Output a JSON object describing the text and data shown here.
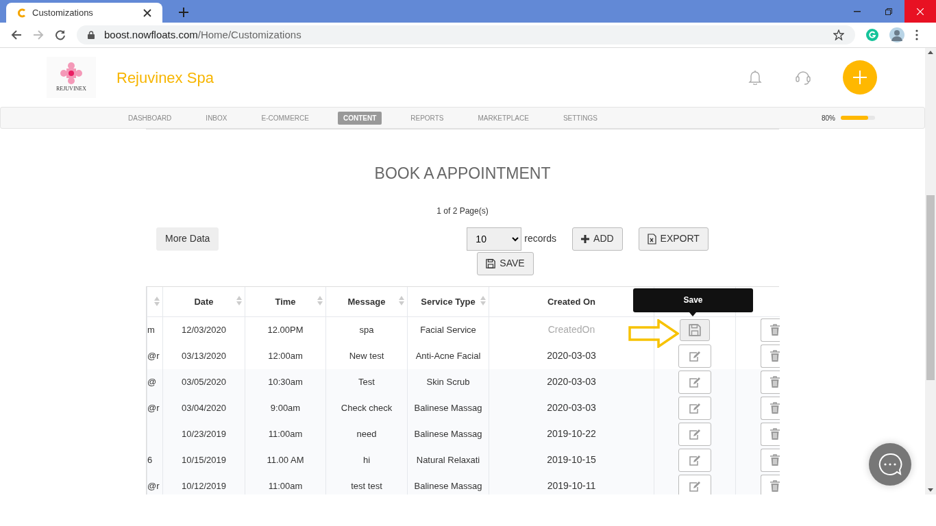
{
  "browser": {
    "tab_title": "Customizations",
    "url_host": "boost.nowfloats.com",
    "url_path": "/Home/Customizations",
    "forward_enabled": false
  },
  "header": {
    "logo_text": "REJUVINEX",
    "brand": "Rejuvinex Spa"
  },
  "nav": [
    {
      "label": "DASHBOARD",
      "selected": false
    },
    {
      "label": "INBOX",
      "selected": false
    },
    {
      "label": "E-COMMERCE",
      "selected": false
    },
    {
      "label": "CONTENT",
      "selected": true
    },
    {
      "label": "REPORTS",
      "selected": false
    },
    {
      "label": "MARKETPLACE",
      "selected": false
    },
    {
      "label": "SETTINGS",
      "selected": false
    }
  ],
  "profile_progress": {
    "reading": "80%",
    "level": 0.8
  },
  "page": {
    "title": "BOOK A APPOINTMENT",
    "pager": "1 of 2 Page(s)",
    "more_button": "More Data",
    "page_size": "10",
    "page_size_label": "records",
    "buttons": [
      {
        "kind": "add",
        "label": "ADD"
      },
      {
        "kind": "export",
        "label": "EXPORT"
      },
      {
        "kind": "save",
        "label": "SAVE"
      }
    ]
  },
  "table": {
    "columns": [
      "Date",
      "Time",
      "Message",
      "Service Type",
      "Created On"
    ],
    "rows": [
      {
        "column_1": "m",
        "cells": [
          "12/03/2020",
          "12.00PM",
          "spa",
          "Facial Service"
        ],
        "editing": true,
        "created_on_placeholder": "CreatedOn"
      },
      {
        "column_1": "@r",
        "cells": [
          "03/13/2020",
          "12:00am",
          "New test",
          "Anti-Acne Facial"
        ],
        "editing": false,
        "created_on": "2020-03-03"
      },
      {
        "column_1": "@",
        "cells": [
          "03/05/2020",
          "10:30am",
          "Test",
          "Skin Scrub"
        ],
        "editing": false,
        "created_on": "2020-03-03"
      },
      {
        "column_1": "@r",
        "cells": [
          "03/04/2020",
          "9:00am",
          "Check check",
          "Balinese Massag"
        ],
        "editing": false,
        "created_on": "2020-03-03"
      },
      {
        "cells": [
          "10/23/2019",
          "11:00am",
          "need",
          "Balinese Massag"
        ],
        "editing": false,
        "created_on": "2019-10-22"
      },
      {
        "column_1": "6",
        "cells": [
          "10/15/2019",
          "11.00 AM",
          "hi",
          "Natural Relaxati"
        ],
        "editing": false,
        "created_on": "2019-10-15"
      },
      {
        "column_1": "@r",
        "cells": [
          "10/12/2019",
          "11:00am",
          "test test",
          "Balinese Massag"
        ],
        "editing": false,
        "created_on": "2019-10-11"
      }
    ]
  },
  "tooltip": "Save"
}
